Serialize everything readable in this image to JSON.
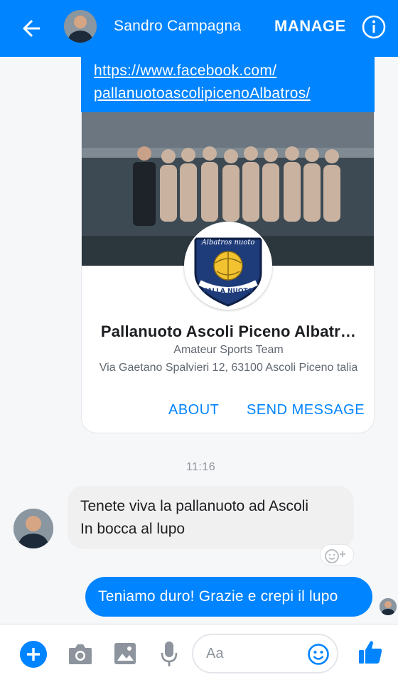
{
  "header": {
    "contact_name": "Sandro Campagna",
    "manage_label": "MANAGE"
  },
  "shared_link": {
    "url_line1": "https://www.facebook.com/",
    "url_line2": "pallanuotoascolipicenoAlbatros/"
  },
  "page_card": {
    "logo_text_top": "Albatros nuoto",
    "logo_text_bottom": "PALLA NUOTO",
    "name": "Pallanuoto Ascoli Piceno Albatr…",
    "category": "Amateur Sports Team",
    "address": "Via Gaetano Spalvieri 12, 63100 Ascoli Piceno talia",
    "about_label": "ABOUT",
    "send_message_label": "SEND MESSAGE"
  },
  "conversation": {
    "timestamp": "11:16",
    "incoming_line1": "Tenete viva la pallanuoto ad Ascoli",
    "incoming_line2": "In bocca al lupo",
    "outgoing": "Teniamo duro! Grazie e crepi il lupo"
  },
  "composer": {
    "placeholder": "Aa"
  },
  "colors": {
    "accent": "#0084ff",
    "incoming_bubble": "#f1f0f0",
    "background": "#f6f7f9"
  },
  "icons": [
    "back-arrow-icon",
    "info-icon",
    "add-icon",
    "camera-icon",
    "gallery-icon",
    "microphone-icon",
    "emoji-icon",
    "thumbs-up-icon",
    "add-reaction-icon"
  ]
}
